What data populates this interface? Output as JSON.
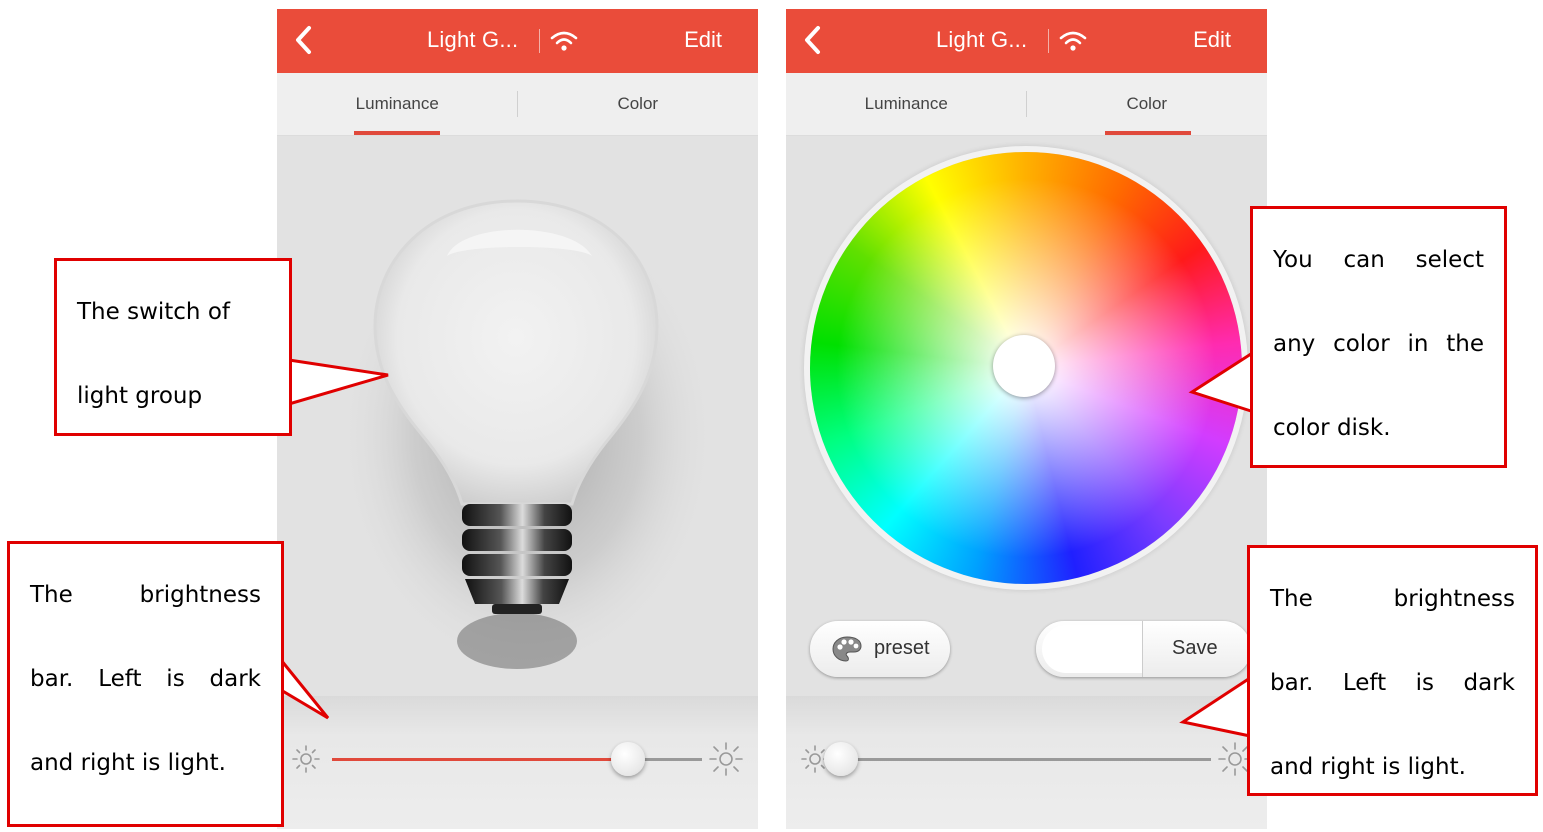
{
  "left_screen": {
    "header": {
      "title": "Light G...",
      "edit_label": "Edit"
    },
    "tabs": [
      {
        "label": "Luminance",
        "active": true
      },
      {
        "label": "Color",
        "active": false
      }
    ],
    "brightness_slider": {
      "value": 0.8
    }
  },
  "right_screen": {
    "header": {
      "title": "Light G...",
      "edit_label": "Edit"
    },
    "tabs": [
      {
        "label": "Luminance",
        "active": false
      },
      {
        "label": "Color",
        "active": true
      }
    ],
    "preset_label": "preset",
    "save_label": "Save",
    "brightness_slider": {
      "value": 0.0
    }
  },
  "callouts": {
    "switch": {
      "line1": "The switch of",
      "line2": "light group"
    },
    "brightness_left": {
      "line1": "The brightness",
      "line2": "bar. Left is dark",
      "line3": "and right is light."
    },
    "color_disk": {
      "line1": "You can select",
      "line2": "any color in the",
      "line3": "color disk."
    },
    "brightness_right": {
      "line1": "The brightness",
      "line2": "bar. Left is dark",
      "line3": "and right is light."
    }
  },
  "colors": {
    "accent": "#ea4c3a",
    "callout_border": "#e00000"
  }
}
